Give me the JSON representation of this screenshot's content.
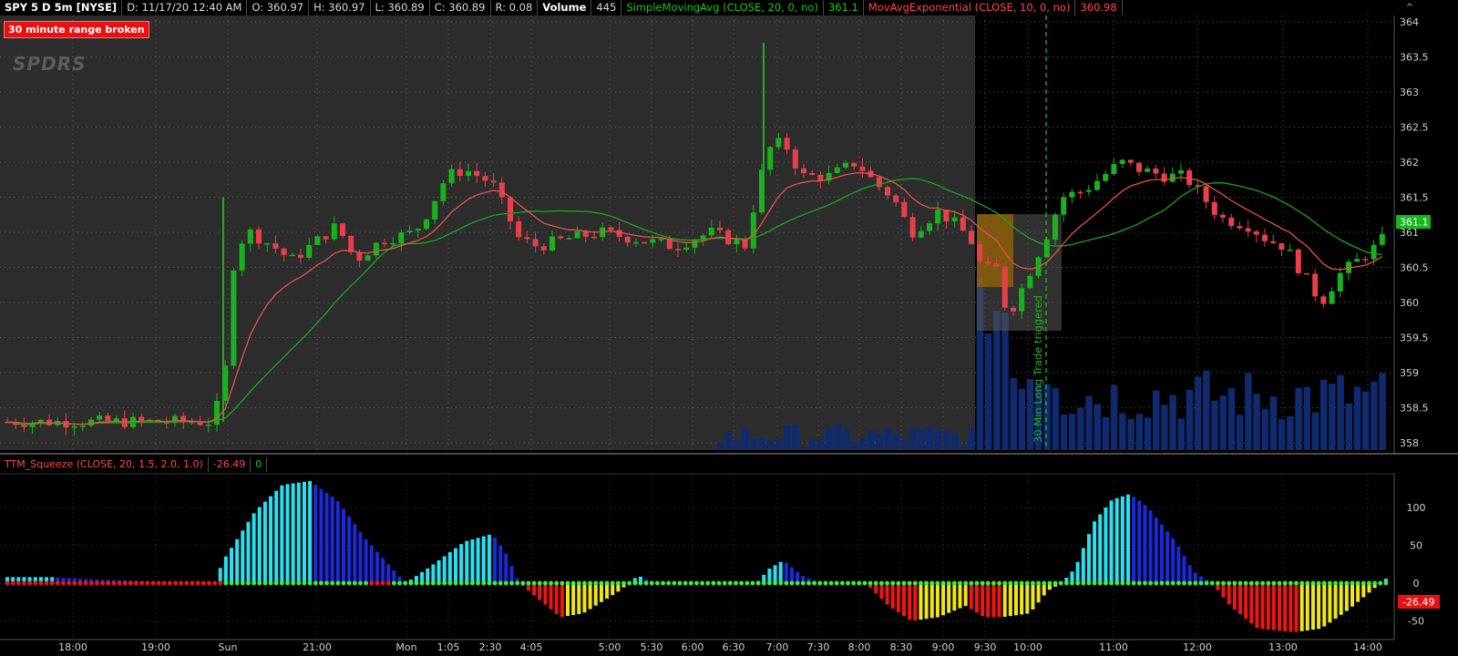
{
  "header": {
    "symbol": "SPY 5 D 5m [NYSE]",
    "date": "D: 11/17/20 12:40 AM",
    "open": "O: 360.97",
    "high": "H: 360.97",
    "low": "L: 360.89",
    "close": "C: 360.89",
    "range": "R: 0.08",
    "volume_label": "Volume",
    "volume_value": "445",
    "sma_label": "SimpleMovingAvg (CLOSE, 20, 0, no)",
    "sma_value": "361.1",
    "ema_label": "MovAvgExponential (CLOSE, 10, 0, no)",
    "ema_value": "360.98"
  },
  "alert_label": "30 minute range broken",
  "logo_text": "SPDRS",
  "annotation_text": "30 Min Long Trade triggered",
  "price_axis": {
    "ticks": [
      "364",
      "363.5",
      "363",
      "362.5",
      "362",
      "361.5",
      "361",
      "360.5",
      "360",
      "359.5",
      "359",
      "358.5",
      "358"
    ],
    "current_price": "361.1"
  },
  "indicator": {
    "label": "TTM_Squeeze (CLOSE, 20, 1.5, 2.0, 1.0)",
    "value": "-26.49",
    "squeeze_value": "0",
    "axis_ticks": [
      "100",
      "50",
      "0",
      "-50"
    ],
    "current_value": "-26.49"
  },
  "time_axis": {
    "labels": [
      "18:00",
      "19:00",
      "Sun",
      "21:00",
      "Mon",
      "1:05",
      "2:30",
      "4:05",
      "5:00",
      "5:30",
      "6:00",
      "6:30",
      "7:00",
      "7:30",
      "8:00",
      "8:30",
      "9:00",
      "9:30",
      "10:00",
      "11:00",
      "12:00",
      "13:00",
      "14:00"
    ]
  },
  "colors": {
    "up_candle": "#19b21e",
    "down_candle": "#e8404a",
    "sma": "#14a81a",
    "ema": "#e8504a",
    "volume": "#0f2a6e",
    "premarket_bg": "#2d2d2d",
    "session_bg": "#000000",
    "hist_cyan": "#28e0f0",
    "hist_blue": "#1a2ad8",
    "hist_red": "#f01414",
    "hist_yellow": "#f0e614",
    "dot_green": "#3cf03c",
    "dot_red": "#f01414"
  },
  "chart_data": [
    {
      "type": "line",
      "title": "SPY 5 D 5m [NYSE]",
      "series": [
        {
          "name": "SimpleMovingAvg (CLOSE, 20, 0, no)",
          "x": [
            "17:30",
            "Sun",
            "21:00",
            "Mon",
            "2:30",
            "5:00",
            "7:00",
            "8:00",
            "9:00",
            "9:30",
            "10:00",
            "11:00",
            "12:00",
            "13:00",
            "14:00"
          ],
          "values": [
            358.3,
            358.3,
            359.9,
            360.9,
            361.4,
            361.1,
            360.9,
            361.6,
            361.5,
            361.2,
            360.8,
            361.2,
            361.7,
            361.2,
            360.7
          ]
        },
        {
          "name": "MovAvgExponential (CLOSE, 10, 0, no)",
          "x": [
            "17:30",
            "Sun",
            "21:00",
            "Mon",
            "2:30",
            "5:00",
            "7:00",
            "8:00",
            "9:00",
            "9:30",
            "10:00",
            "11:00",
            "12:00",
            "13:00",
            "14:00"
          ],
          "values": [
            358.3,
            358.3,
            360.5,
            360.8,
            361.6,
            361.0,
            361.0,
            362.0,
            361.1,
            360.4,
            360.6,
            361.7,
            361.9,
            360.6,
            360.8
          ]
        }
      ],
      "ylim": [
        358,
        364
      ],
      "current_price": 361.1
    },
    {
      "type": "bar",
      "title": "TTM_Squeeze (CLOSE, 20, 1.5, 2.0, 1.0)",
      "ylim": [
        -60,
        140
      ],
      "current_value": -26.49
    }
  ]
}
